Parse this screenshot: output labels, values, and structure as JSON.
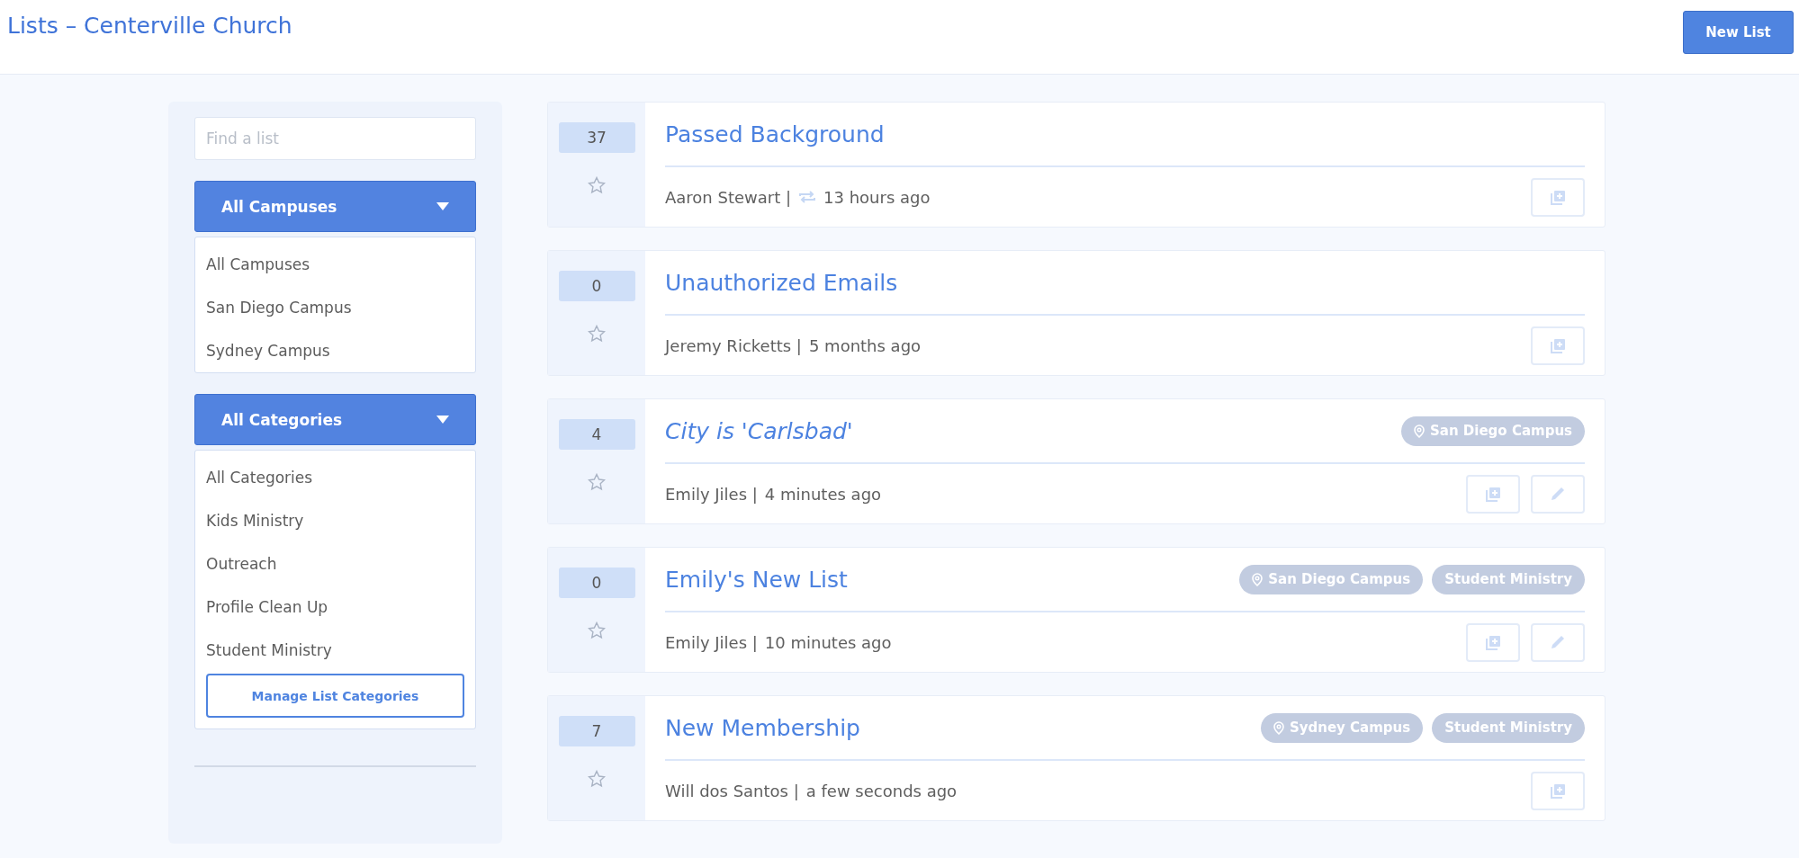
{
  "header": {
    "title": "Lists – Centerville Church",
    "new_button": "New List"
  },
  "sidebar": {
    "search": {
      "placeholder": "Find a list"
    },
    "filters": [
      {
        "label": "All Campuses",
        "options": [
          "All Campuses",
          "San Diego Campus",
          "Sydney Campus"
        ]
      },
      {
        "label": "All Categories",
        "options": [
          "All Categories",
          "Kids Ministry",
          "Outreach",
          "Profile Clean Up",
          "Student Ministry"
        ],
        "manage_button": "Manage List Categories"
      }
    ]
  },
  "lists": [
    {
      "count": "37",
      "starred": false,
      "title": "Passed Background",
      "dynamic": false,
      "author": "Aaron Stewart |",
      "synced": true,
      "time": "13 hours ago",
      "editable": false
    },
    {
      "count": "0",
      "starred": false,
      "title": "Unauthorized Emails",
      "dynamic": false,
      "author": "Jeremy Ricketts |",
      "synced": false,
      "time": "5 months ago",
      "editable": false
    },
    {
      "count": "4",
      "starred": false,
      "title": "City is 'Carlsbad'",
      "dynamic": true,
      "author": "Emily Jiles |",
      "synced": false,
      "time": "4 minutes ago",
      "tags": [
        {
          "kind": "campus",
          "label": "San Diego Campus"
        }
      ],
      "editable": true
    },
    {
      "count": "0",
      "starred": false,
      "title": "Emily's New List",
      "dynamic": false,
      "author": "Emily Jiles |",
      "synced": false,
      "time": "10 minutes ago",
      "tags": [
        {
          "kind": "campus",
          "label": "San Diego Campus"
        },
        {
          "kind": "category",
          "label": "Student Ministry"
        }
      ],
      "editable": true
    },
    {
      "count": "7",
      "starred": false,
      "title": "New Membership",
      "dynamic": false,
      "author": "Will dos Santos |",
      "synced": false,
      "time": "a few seconds ago",
      "tags": [
        {
          "kind": "campus",
          "label": "Sydney Campus"
        },
        {
          "kind": "category",
          "label": "Student Ministry"
        }
      ],
      "editable": false
    }
  ]
}
